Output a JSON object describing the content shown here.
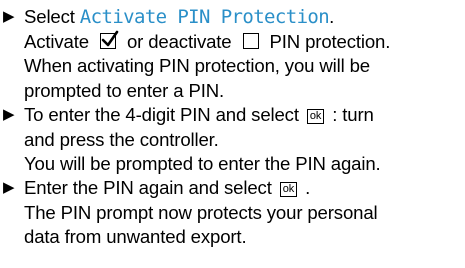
{
  "bullet_glyph": "▶",
  "steps": [
    {
      "line1_prefix": "Select ",
      "line1_menu": "Activate PIN Protection",
      "line1_suffix": ".",
      "line2_a": "Activate ",
      "line2_b": " or deactivate ",
      "line2_c": " PIN protection.",
      "line3": "When activating PIN protection, you will be",
      "line4": "prompted to enter a PIN.",
      "checked_icon": "checkbox-checked-icon",
      "unchecked_icon": "checkbox-unchecked-icon"
    },
    {
      "line1_a": "To enter the 4-digit PIN and select ",
      "line1_key": "ok",
      "line1_b": " : turn",
      "line2": "and press the controller.",
      "line3": "You will be prompted to enter the PIN again."
    },
    {
      "line1_a": "Enter the PIN again and select ",
      "line1_key": "ok",
      "line1_b": " .",
      "line2": "The PIN prompt now protects your personal",
      "line3": "data from unwanted export."
    }
  ],
  "colors": {
    "menu_text": "#2a8fc8",
    "text": "#000000"
  }
}
